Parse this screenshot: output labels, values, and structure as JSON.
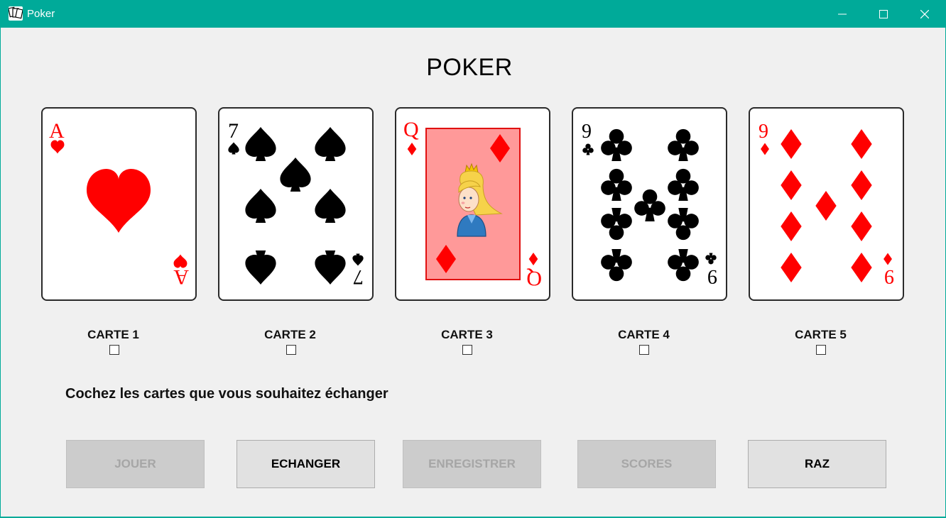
{
  "window": {
    "title": "Poker",
    "app_icon": "cards-app-icon",
    "controls": [
      "minimize-icon",
      "maximize-icon",
      "close-icon"
    ]
  },
  "heading": "POKER",
  "cards": [
    {
      "label": "CARTE 1",
      "rank": "A",
      "suit": "hearts",
      "color": "#ff0000",
      "checked": false
    },
    {
      "label": "CARTE 2",
      "rank": "7",
      "suit": "spades",
      "color": "#000000",
      "checked": false
    },
    {
      "label": "CARTE 3",
      "rank": "Q",
      "suit": "diamonds",
      "color": "#ff0000",
      "checked": false
    },
    {
      "label": "CARTE 4",
      "rank": "9",
      "suit": "clubs",
      "color": "#000000",
      "checked": false
    },
    {
      "label": "CARTE 5",
      "rank": "9",
      "suit": "diamonds",
      "color": "#ff0000",
      "checked": false
    }
  ],
  "instruction": "Cochez les cartes que vous souhaitez échanger",
  "buttons": [
    {
      "label": "JOUER",
      "enabled": false
    },
    {
      "label": "ECHANGER",
      "enabled": true
    },
    {
      "label": "ENREGISTRER",
      "enabled": false
    },
    {
      "label": "SCORES",
      "enabled": false
    },
    {
      "label": "RAZ",
      "enabled": true
    }
  ],
  "colors": {
    "titlebar": "#00aa99",
    "background": "#f0f0f0",
    "red_suit": "#ff0000",
    "black_suit": "#000000",
    "queen_panel": "#ff9999"
  }
}
